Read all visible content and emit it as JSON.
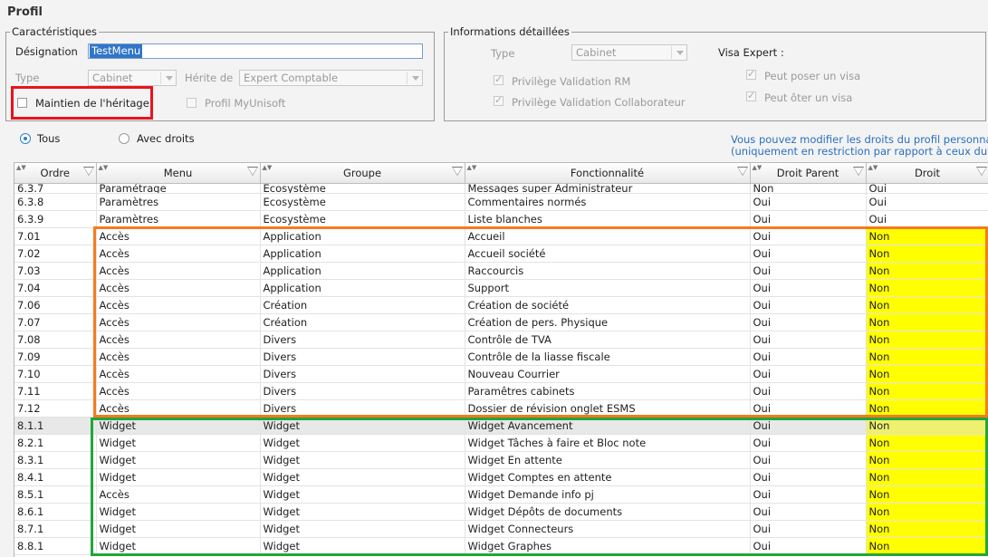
{
  "page_title": "Profil",
  "caracteristiques": {
    "legend": "Caractéristiques",
    "designation_label": "Désignation",
    "designation_value": "TestMenu",
    "type_label": "Type",
    "type_value": "Cabinet",
    "herite_label": "Hérite de",
    "herite_value": "Expert Comptable",
    "maintien_label": "Maintien de l'héritage",
    "myunisoft_label": "Profil MyUnisoft"
  },
  "informations": {
    "legend": "Informations détaillées",
    "type_label": "Type",
    "type_value": "Cabinet",
    "visa_expert_label": "Visa Expert :",
    "privilege_rm_label": "Privilège Validation RM",
    "privilege_collab_label": "Privilège Validation Collaborateur",
    "poser_visa_label": "Peut poser un visa",
    "oter_visa_label": "Peut ôter un visa"
  },
  "filter": {
    "tous_label": "Tous",
    "avec_droits_label": "Avec droits"
  },
  "info_text": {
    "line1": "Vous pouvez modifier les droits du profil personna",
    "line2": "(uniquement en restriction par rapport à ceux du"
  },
  "columns": [
    "Ordre",
    "Menu",
    "Groupe",
    "Fonctionnalité",
    "Droit Parent",
    "Droit"
  ],
  "rows": [
    {
      "ordre": "6.3.7",
      "menu": "Paramétrage",
      "groupe": "Ecosystème",
      "fonc": "Messages super Administrateur",
      "parent": "Non",
      "droit": "Oui"
    },
    {
      "ordre": "6.3.8",
      "menu": "Paramètres",
      "groupe": "Ecosystème",
      "fonc": "Commentaires normés",
      "parent": "Oui",
      "droit": "Oui"
    },
    {
      "ordre": "6.3.9",
      "menu": "Paramètres",
      "groupe": "Ecosystème",
      "fonc": "Liste blanches",
      "parent": "Oui",
      "droit": "Oui"
    },
    {
      "ordre": "7.01",
      "menu": "Accès",
      "groupe": "Application",
      "fonc": "Accueil",
      "parent": "Oui",
      "droit": "Non"
    },
    {
      "ordre": "7.02",
      "menu": "Accès",
      "groupe": "Application",
      "fonc": "Accueil société",
      "parent": "Oui",
      "droit": "Non"
    },
    {
      "ordre": "7.03",
      "menu": "Accès",
      "groupe": "Application",
      "fonc": "Raccourcis",
      "parent": "Oui",
      "droit": "Non"
    },
    {
      "ordre": "7.04",
      "menu": "Accès",
      "groupe": "Application",
      "fonc": "Support",
      "parent": "Oui",
      "droit": "Non"
    },
    {
      "ordre": "7.06",
      "menu": "Accès",
      "groupe": "Création",
      "fonc": "Création de société",
      "parent": "Oui",
      "droit": "Non"
    },
    {
      "ordre": "7.07",
      "menu": "Accès",
      "groupe": "Création",
      "fonc": "Création de pers. Physique",
      "parent": "Oui",
      "droit": "Non"
    },
    {
      "ordre": "7.08",
      "menu": "Accès",
      "groupe": "Divers",
      "fonc": "Contrôle de TVA",
      "parent": "Oui",
      "droit": "Non"
    },
    {
      "ordre": "7.09",
      "menu": "Accès",
      "groupe": "Divers",
      "fonc": "Contrôle de la liasse fiscale",
      "parent": "Oui",
      "droit": "Non"
    },
    {
      "ordre": "7.10",
      "menu": "Accès",
      "groupe": "Divers",
      "fonc": "Nouveau Courrier",
      "parent": "Oui",
      "droit": "Non"
    },
    {
      "ordre": "7.11",
      "menu": "Accès",
      "groupe": "Divers",
      "fonc": "Paramêtres cabinets",
      "parent": "Oui",
      "droit": "Non"
    },
    {
      "ordre": "7.12",
      "menu": "Accès",
      "groupe": "Divers",
      "fonc": "Dossier de révision onglet ESMS",
      "parent": "Oui",
      "droit": "Non"
    },
    {
      "ordre": "8.1.1",
      "menu": "Widget",
      "groupe": "Widget",
      "fonc": "Widget Avancement",
      "parent": "Oui",
      "droit": "Non"
    },
    {
      "ordre": "8.2.1",
      "menu": "Widget",
      "groupe": "Widget",
      "fonc": "Widget Tâches à faire et Bloc note",
      "parent": "Oui",
      "droit": "Non"
    },
    {
      "ordre": "8.3.1",
      "menu": "Widget",
      "groupe": "Widget",
      "fonc": "Widget En attente",
      "parent": "Oui",
      "droit": "Non"
    },
    {
      "ordre": "8.4.1",
      "menu": "Widget",
      "groupe": "Widget",
      "fonc": "Widget Comptes en attente",
      "parent": "Oui",
      "droit": "Non"
    },
    {
      "ordre": "8.5.1",
      "menu": "Accès",
      "groupe": "Widget",
      "fonc": "Widget Demande info pj",
      "parent": "Oui",
      "droit": "Non"
    },
    {
      "ordre": "8.6.1",
      "menu": "Widget",
      "groupe": "Widget",
      "fonc": "Widget Dépôts de documents",
      "parent": "Oui",
      "droit": "Non"
    },
    {
      "ordre": "8.7.1",
      "menu": "Widget",
      "groupe": "Widget",
      "fonc": "Widget Connecteurs",
      "parent": "Oui",
      "droit": "Non"
    },
    {
      "ordre": "8.8.1",
      "menu": "Widget",
      "groupe": "Widget",
      "fonc": "Widget Graphes",
      "parent": "Oui",
      "droit": "Non"
    }
  ],
  "highlight_color": "#ffff00",
  "annotation_colors": {
    "red": "#e8141c",
    "orange": "#f47b20",
    "green": "#22a63a"
  }
}
